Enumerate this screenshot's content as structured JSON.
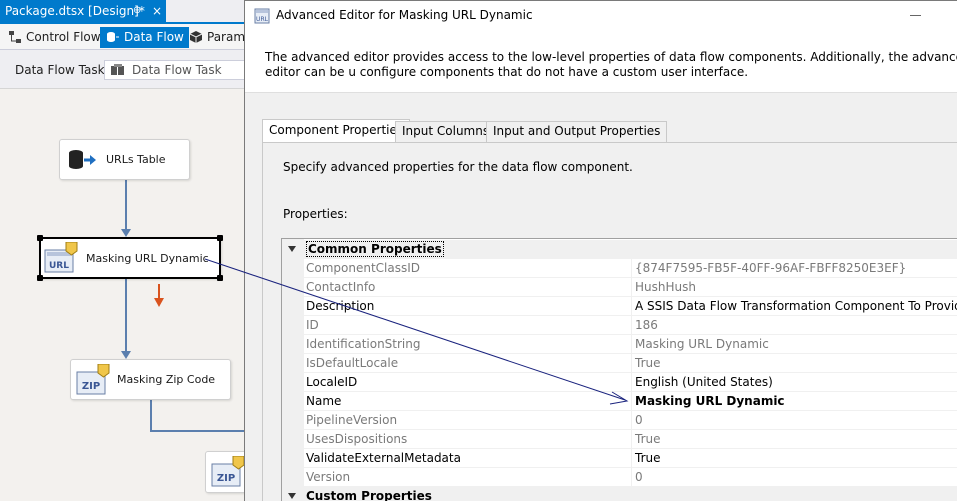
{
  "doc_tab": {
    "title": "Package.dtsx [Design]*",
    "pin_glyph": "⊕",
    "close_glyph": "×"
  },
  "designer_tabs": {
    "control_flow": "Control Flow",
    "data_flow": "Data Flow",
    "parameters": "Parame"
  },
  "task_bar": {
    "label": "Data Flow Task:",
    "value": "Data Flow Task"
  },
  "nodes": {
    "urls_table": "URLs Table",
    "masking_url": "Masking URL Dynamic",
    "masking_zip": "Masking Zip Code",
    "url_icon_text": "URL",
    "zip_icon_text": "ZIP"
  },
  "dialog": {
    "title": "Advanced Editor for Masking URL Dynamic",
    "description": "The advanced editor provides access to the low-level properties of data flow components. Additionally, the advanced editor can be u configure components that do not have a custom user interface.",
    "tabs": [
      "Component Properties",
      "Input Columns",
      "Input and Output Properties"
    ],
    "instructions": "Specify advanced properties for the data flow component.",
    "properties_label": "Properties:",
    "categories": {
      "common": "Common Properties",
      "custom": "Custom Properties"
    },
    "properties": [
      {
        "name": "ComponentClassID",
        "value": "{874F7595-FB5F-40FF-96AF-FBFF8250E3EF}"
      },
      {
        "name": "ContactInfo",
        "value": "HushHush"
      },
      {
        "name": "Description",
        "value": "A SSIS Data Flow Transformation Component To Provide Dyna"
      },
      {
        "name": "ID",
        "value": "186"
      },
      {
        "name": "IdentificationString",
        "value": "Masking URL Dynamic"
      },
      {
        "name": "IsDefaultLocale",
        "value": "True"
      },
      {
        "name": "LocaleID",
        "value": "English (United States)"
      },
      {
        "name": "Name",
        "value": "Masking URL Dynamic"
      },
      {
        "name": "PipelineVersion",
        "value": "0"
      },
      {
        "name": "UsesDispositions",
        "value": "True"
      },
      {
        "name": "ValidateExternalMetadata",
        "value": "True"
      },
      {
        "name": "Version",
        "value": "0"
      }
    ]
  },
  "colors": {
    "accent": "#007acc",
    "annotation_arrow": "#1a237e",
    "error_path": "#d9531e"
  }
}
